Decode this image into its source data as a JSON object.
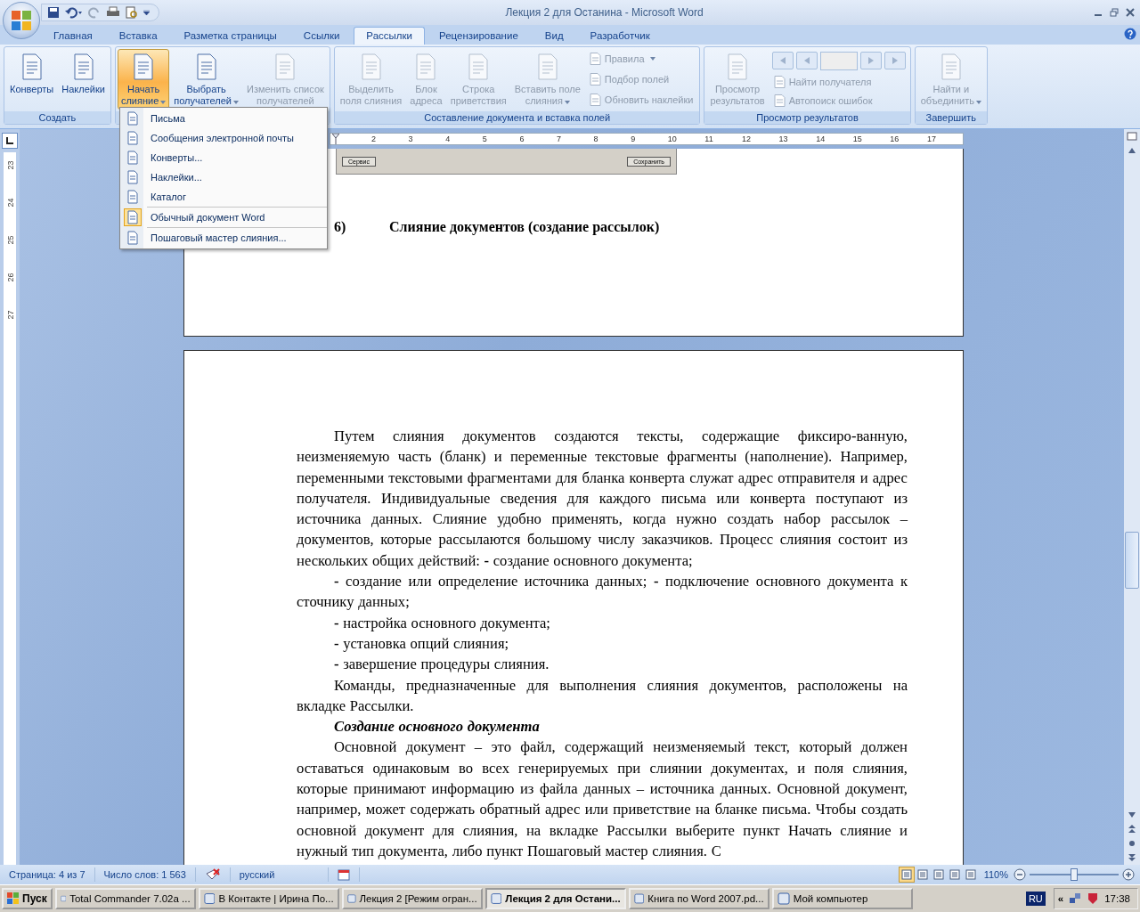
{
  "window": {
    "title": "Лекция 2 для Останина - Microsoft Word"
  },
  "tabs": [
    {
      "label": "Главная",
      "selected": false
    },
    {
      "label": "Вставка",
      "selected": false
    },
    {
      "label": "Разметка страницы",
      "selected": false
    },
    {
      "label": "Ссылки",
      "selected": false
    },
    {
      "label": "Рассылки",
      "selected": true
    },
    {
      "label": "Рецензирование",
      "selected": false
    },
    {
      "label": "Вид",
      "selected": false
    },
    {
      "label": "Разработчик",
      "selected": false
    }
  ],
  "ribbon": [
    {
      "label": "Создать",
      "items": [
        {
          "kind": "large",
          "lines": [
            "Конверты"
          ],
          "disabled": false,
          "dropdown": false,
          "pressed": false
        },
        {
          "kind": "large",
          "lines": [
            "Наклейки"
          ],
          "disabled": false,
          "dropdown": false,
          "pressed": false
        }
      ]
    },
    {
      "items": [
        {
          "kind": "large",
          "lines": [
            "Начать",
            "слияние"
          ],
          "disabled": false,
          "dropdown": true,
          "pressed": true
        },
        {
          "kind": "large",
          "lines": [
            "Выбрать",
            "получателей"
          ],
          "disabled": false,
          "dropdown": true,
          "pressed": false
        },
        {
          "kind": "large",
          "lines": [
            "Изменить список",
            "получателей"
          ],
          "disabled": true,
          "dropdown": false,
          "pressed": false
        }
      ]
    },
    {
      "label": "Составление документа и вставка полей",
      "items": [
        {
          "kind": "large",
          "lines": [
            "Выделить",
            "поля слияния"
          ],
          "disabled": true,
          "dropdown": false,
          "pressed": false
        },
        {
          "kind": "large",
          "lines": [
            "Блок",
            "адреса"
          ],
          "disabled": true,
          "dropdown": false,
          "pressed": false
        },
        {
          "kind": "large",
          "lines": [
            "Строка",
            "приветствия"
          ],
          "disabled": true,
          "dropdown": false,
          "pressed": false
        },
        {
          "kind": "large",
          "lines": [
            "Вставить поле",
            "слияния"
          ],
          "disabled": true,
          "dropdown": true,
          "pressed": false
        },
        {
          "kind": "stack",
          "children": [
            {
              "kind": "small",
              "label": "Правила",
              "disabled": true,
              "dropdown": true
            },
            {
              "kind": "small",
              "label": "Подбор полей",
              "disabled": true,
              "dropdown": false
            },
            {
              "kind": "small",
              "label": "Обновить наклейки",
              "disabled": true,
              "dropdown": false
            }
          ]
        }
      ]
    },
    {
      "label": "Просмотр результатов",
      "items": [
        {
          "kind": "large",
          "lines": [
            "Просмотр",
            "результатов"
          ],
          "disabled": true,
          "dropdown": false,
          "pressed": false
        },
        {
          "kind": "stack",
          "children": [
            {
              "kind": "nav"
            },
            {
              "kind": "small",
              "label": "Найти получателя",
              "disabled": true,
              "dropdown": false
            },
            {
              "kind": "small",
              "label": "Автопоиск ошибок",
              "disabled": true,
              "dropdown": false
            }
          ]
        }
      ]
    },
    {
      "label": "Завершить",
      "items": [
        {
          "kind": "large",
          "lines": [
            "Найти и",
            "объединить"
          ],
          "disabled": true,
          "dropdown": true,
          "pressed": false
        }
      ]
    }
  ],
  "menu": {
    "sections": [
      {
        "items": [
          {
            "label": "Письма",
            "checked": false
          },
          {
            "label": "Сообщения электронной почты",
            "checked": false
          },
          {
            "label": "Конверты...",
            "checked": false
          },
          {
            "label": "Наклейки...",
            "checked": false
          },
          {
            "label": "Каталог",
            "checked": false
          }
        ]
      },
      {
        "items": [
          {
            "label": "Обычный документ Word",
            "checked": true
          }
        ]
      },
      {
        "items": [
          {
            "label": "Пошаговый мастер слияния...",
            "checked": false
          }
        ]
      }
    ]
  },
  "ruler": {
    "marks": [
      "2",
      "3",
      "4",
      "5",
      "6",
      "7",
      "8",
      "9",
      "10",
      "11",
      "12",
      "13",
      "14",
      "15",
      "16",
      "17"
    ]
  },
  "vertical_ruler": {
    "marks": [
      "23",
      "24",
      "25",
      "26",
      "27"
    ]
  },
  "page1": {
    "embedded_buttons": [
      "Сервис",
      "Сохранить"
    ],
    "heading_number": "6)",
    "heading": "Слияние документов (создание рассылок)"
  },
  "page2": {
    "paragraphs": [
      {
        "kind": "body",
        "text": "Путем слияния документов создаются тексты, содержащие фиксиро-ванную, неизменяемую часть (бланк) и переменные текстовые фрагменты (наполнение). Например, переменными текстовыми фрагментами для бланка конверта служат адрес отправителя и адрес получателя. Индивидуальные сведения для каждого письма или конверта поступают из источника данных. Слияние удобно применять, когда нужно создать набор рассылок – документов, которые рассылаются большому числу заказчиков. Процесс слияния состоит из нескольких общих действий: **-** создание основного документа;"
      },
      {
        "kind": "body",
        "text": "**-** создание или определение источника данных; **-** подключение основного документа к сточнику данных;"
      },
      {
        "kind": "body",
        "text": "**-** настройка основного документа;"
      },
      {
        "kind": "body",
        "text": "**-** установка опций слияния;"
      },
      {
        "kind": "body",
        "text": "**-** завершение процедуры слияния."
      },
      {
        "kind": "body",
        "text": "Команды, предназначенные для выполнения слияния документов, расположены на вкладке Рассылки."
      },
      {
        "kind": "heading",
        "text": "Создание основного документа"
      },
      {
        "kind": "body",
        "text": "Основной документ – это файл, содержащий неизменяемый текст, который должен оставаться одинаковым во всех генерируемых при слиянии документах, и поля слияния, которые принимают информацию из файла данных – источника данных. Основной документ, например, может содержать обратный адрес или приветствие на бланке письма. Чтобы создать основной документ для слияния, на вкладке Рассылки выберите пункт Начать слияние и нужный тип документа, либо пункт Пошаговый мастер слияния. С"
      }
    ]
  },
  "status": {
    "page": "Страница: 4 из 7",
    "words": "Число слов: 1 563",
    "language": "русский",
    "views": [
      {
        "selected": true
      },
      {
        "selected": false
      },
      {
        "selected": false
      },
      {
        "selected": false
      },
      {
        "selected": false
      }
    ],
    "zoom": "110%",
    "zoom_slider": {
      "level": 0.5
    }
  },
  "taskbar": {
    "start": "Пуск",
    "tasks": [
      {
        "label": "Total Commander 7.02a ...",
        "selected": false
      },
      {
        "label": "В Контакте | Ирина По...",
        "selected": false
      },
      {
        "label": "Лекция 2 [Режим огран...",
        "selected": false
      },
      {
        "label": "Лекция 2 для Остани...",
        "selected": true
      },
      {
        "label": "Книга по Word 2007.pd...",
        "selected": false
      },
      {
        "label": "Мой компьютер",
        "selected": false
      }
    ],
    "language": "RU",
    "tray_toggle": "«",
    "time": "17:38"
  }
}
